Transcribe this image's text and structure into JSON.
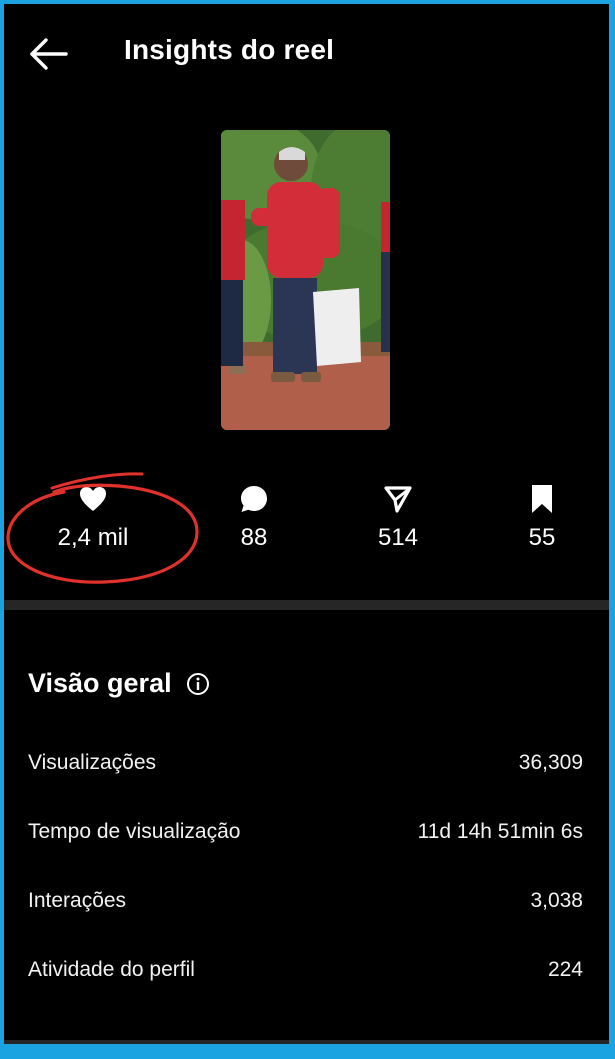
{
  "header": {
    "title": "Insights do reel"
  },
  "stats": [
    {
      "icon": "heart-icon",
      "value": "2,4 mil"
    },
    {
      "icon": "comment-bubble-icon",
      "value": "88"
    },
    {
      "icon": "send-paper-plane-icon",
      "value": "514"
    },
    {
      "icon": "bookmark-icon",
      "value": "55"
    }
  ],
  "overview": {
    "title": "Visão geral",
    "rows": [
      {
        "label": "Visualizações",
        "value": "36,309"
      },
      {
        "label": "Tempo de visualização",
        "value": "11d 14h 51min 6s"
      },
      {
        "label": "Interações",
        "value": "3,038"
      },
      {
        "label": "Atividade do perfil",
        "value": "224"
      }
    ]
  },
  "colors": {
    "frame": "#1aa3e0",
    "background": "#000000",
    "divider": "#262626",
    "annotation": "#e0312b",
    "text": "#ffffff"
  }
}
